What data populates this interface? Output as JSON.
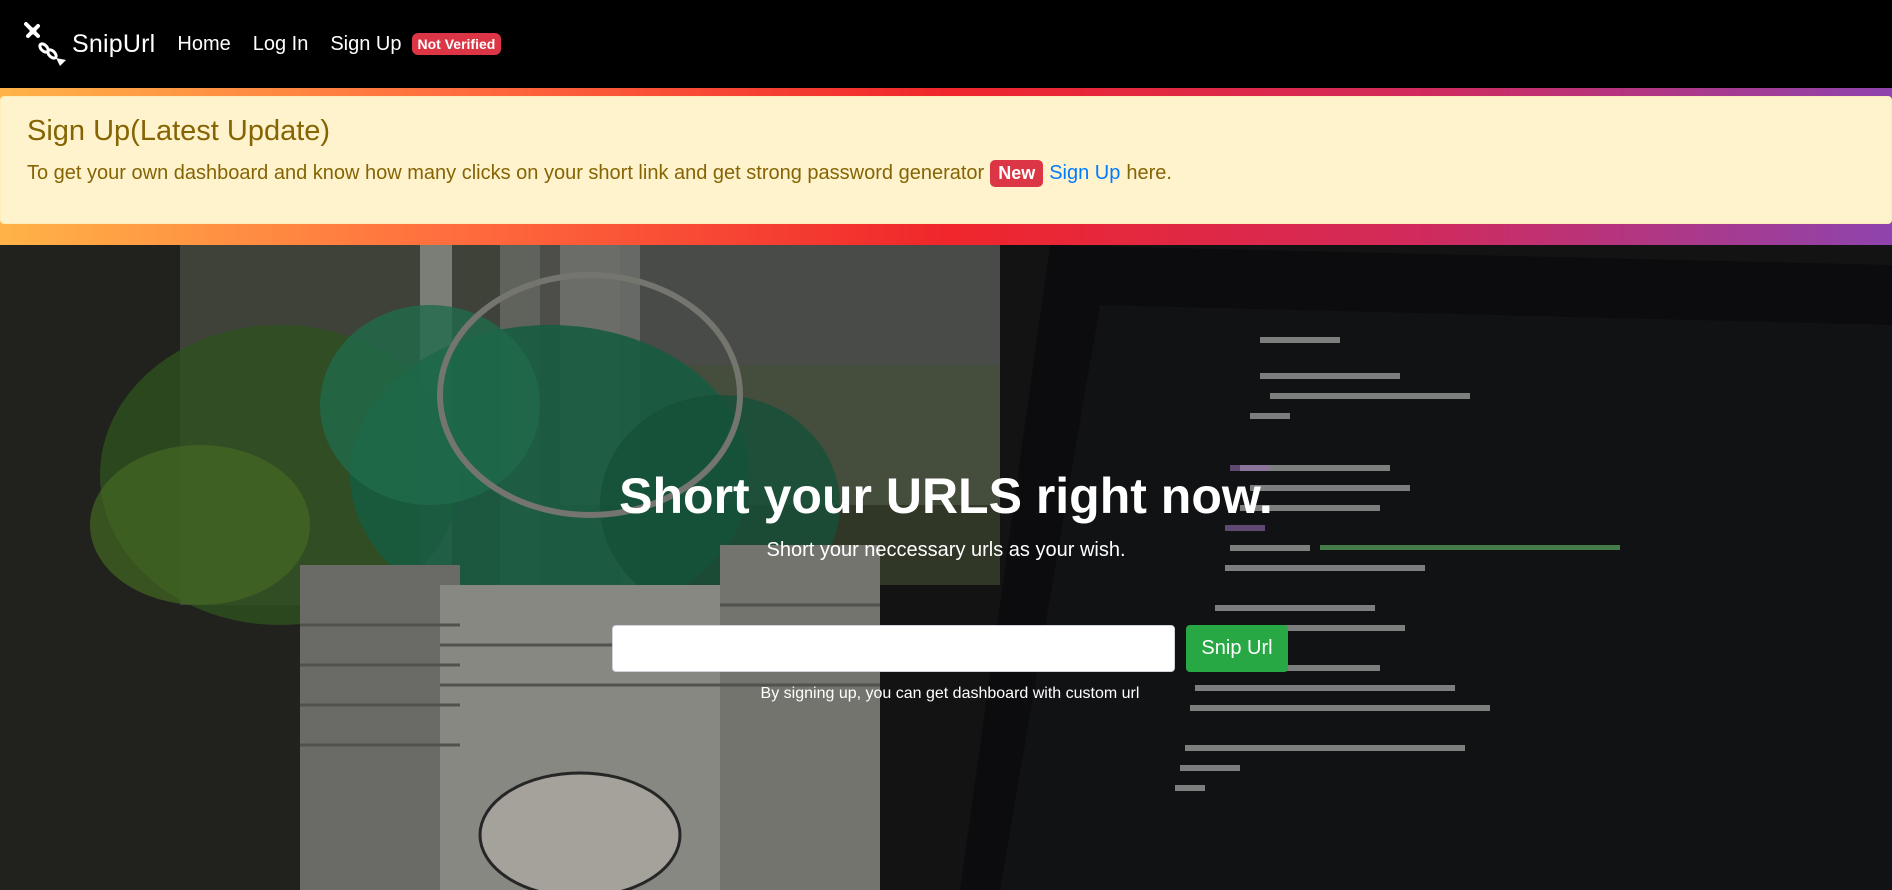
{
  "navbar": {
    "brand": "SnipUrl",
    "links": [
      {
        "label": "Home"
      },
      {
        "label": "Log In"
      },
      {
        "label": "Sign Up"
      }
    ],
    "status_badge": "Not Verified"
  },
  "alert": {
    "heading": "Sign Up(Latest Update)",
    "text": "To get your own dashboard and know how many clicks on your short link and get strong password generator",
    "badge": "New",
    "link_label": "Sign Up",
    "suffix": "here."
  },
  "hero": {
    "title": "Short your URLS right now.",
    "subtitle": "Short your neccessary urls as your wish.",
    "input_value": "",
    "input_placeholder": "",
    "button_label": "Snip Url",
    "note": "By signing up, you can get dashboard with custom url"
  },
  "colors": {
    "navbar_bg": "#000000",
    "alert_bg": "#fff3cd",
    "alert_text": "#856404",
    "badge_red": "#dc3545",
    "link_blue": "#007bff",
    "button_green": "#28a745"
  },
  "icons": {
    "brand_logo": "scissors-link-icon"
  }
}
